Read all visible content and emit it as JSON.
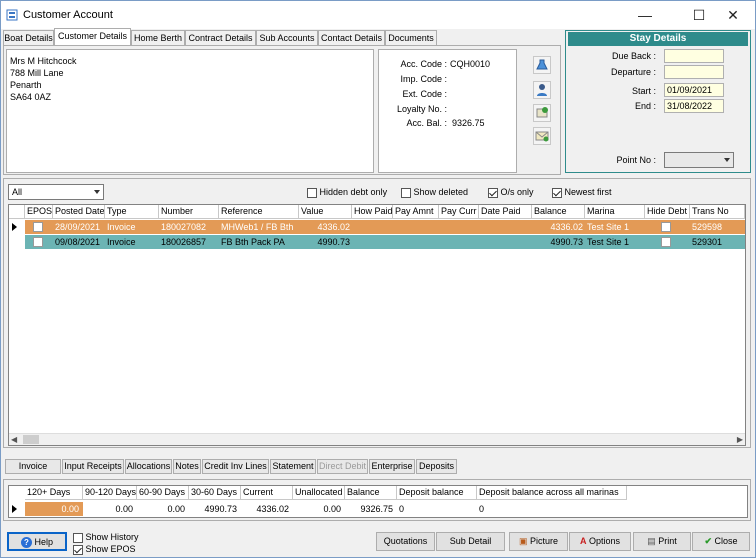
{
  "window": {
    "title": "Customer Account",
    "minimize": "—",
    "maximize": "☐",
    "close": "✕"
  },
  "tabs": [
    "Boat Details",
    "Customer Details",
    "Home Berth",
    "Contract Details",
    "Sub Accounts",
    "Contact Details",
    "Documents"
  ],
  "address": {
    "line1": "Mrs M Hitchcock",
    "line2": "788 Mill Lane",
    "line3": "Penarth",
    "line4": "SA64 0AZ"
  },
  "account": {
    "acc_code_label": "Acc. Code :",
    "acc_code": "CQH0010",
    "imp_code_label": "Imp. Code :",
    "ext_code_label": "Ext. Code :",
    "loyalty_label": "Loyalty No. :",
    "acc_bal_label": "Acc. Bal. :",
    "acc_bal": "9326.75"
  },
  "stay": {
    "title": "Stay Details",
    "due_back_label": "Due Back :",
    "departure_label": "Departure :",
    "start_label": "Start :",
    "start": "01/09/2021",
    "end_label": "End :",
    "end": "31/08/2022",
    "point_label": "Point No :"
  },
  "filters": {
    "combo": "All",
    "hidden_debt": "Hidden debt only",
    "show_deleted": "Show deleted",
    "os_only": "O/s only",
    "newest_first": "Newest first"
  },
  "grid": {
    "headers": [
      "EPOS",
      "Posted Date",
      "Type",
      "Number",
      "Reference",
      "Value",
      "How Paid",
      "Pay Amnt",
      "Pay Curr",
      "Date Paid",
      "Balance",
      "Marina",
      "Hide Debt",
      "Trans No"
    ],
    "rows": [
      {
        "posted": "28/09/2021",
        "type": "Invoice",
        "number": "180027082",
        "reference": "MHWeb1 / FB Bth",
        "value": "4336.02",
        "balance": "4336.02",
        "marina": "Test Site 1",
        "trans": "529598",
        "color": "#e39a56"
      },
      {
        "posted": "09/08/2021",
        "type": "Invoice",
        "number": "180026857",
        "reference": "FB Bth Pack PA",
        "value": "4990.73",
        "balance": "4990.73",
        "marina": "Test Site 1",
        "trans": "529301",
        "color": "#6cb4b4"
      }
    ]
  },
  "bottom_tabs": [
    "Invoice",
    "Input Receipts",
    "Allocations",
    "Notes",
    "Credit Inv Lines",
    "Statement",
    "Direct Debit",
    "Enterprise",
    "Deposits"
  ],
  "aging": {
    "headers": [
      "120+ Days",
      "90-120 Days",
      "60-90 Days",
      "30-60 Days",
      "Current",
      "Unallocated",
      "Balance",
      "Deposit balance",
      "Deposit balance across all marinas"
    ],
    "values": [
      "0.00",
      "0.00",
      "0.00",
      "4990.73",
      "4336.02",
      "0.00",
      "9326.75",
      "0",
      "0"
    ]
  },
  "footer": {
    "help": "Help",
    "show_history": "Show History",
    "show_epos": "Show EPOS",
    "quotations": "Quotations",
    "sub_detail": "Sub Detail",
    "picture": "Picture",
    "options": "Options",
    "print": "Print",
    "close": "Close"
  },
  "colors": {
    "stay_header": "#2e8b8b",
    "row1": "#e39a56",
    "row2": "#6cb4b4",
    "input_yellow": "#ffffe1"
  }
}
